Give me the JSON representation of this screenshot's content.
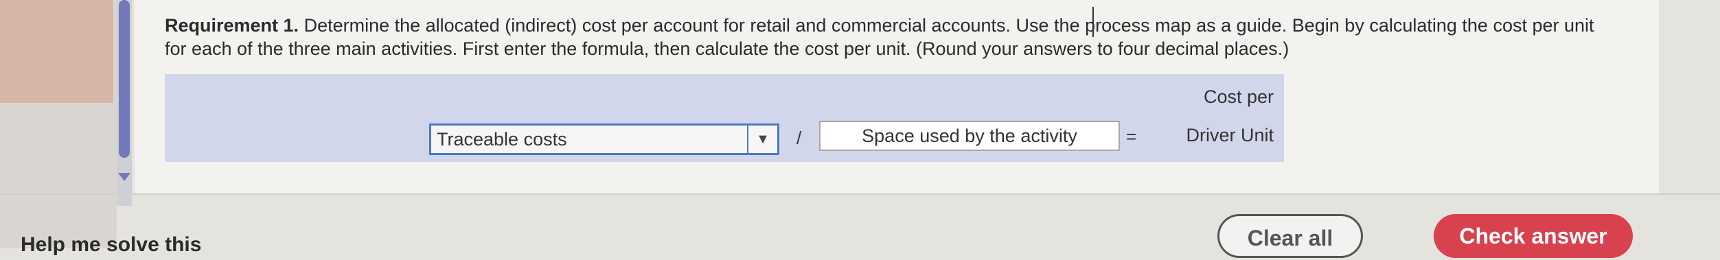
{
  "question": {
    "req_label": "Requirement 1.",
    "text": " Determine the allocated (indirect) cost per account for retail and commercial accounts. Use the process map as a guide. Begin by calculating the cost per unit for each of the three main activities. First enter the formula, then calculate the cost per unit. (Round your answers to four decimal places.)"
  },
  "formula": {
    "numerator_select": "Traceable costs",
    "operator": "/",
    "denominator_value": "Space used by the activity",
    "equals": "=",
    "result_header_line1": "Cost per",
    "result_header_line2": "Driver Unit"
  },
  "buttons": {
    "clear": "Clear all",
    "check": "Check answer"
  },
  "bottom_partial_text": "Help me solve this"
}
